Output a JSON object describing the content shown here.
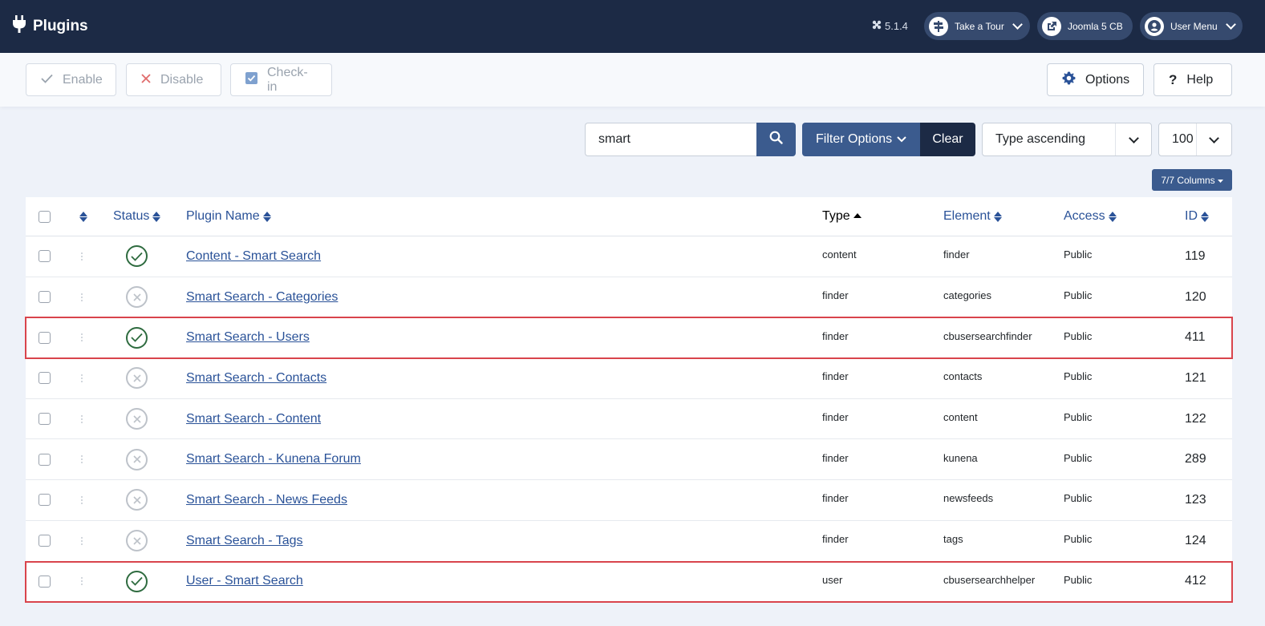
{
  "header": {
    "title": "Plugins",
    "version": "5.1.4",
    "take_tour": "Take a Tour",
    "site_link": "Joomla 5 CB",
    "user_menu": "User Menu"
  },
  "toolbar": {
    "enable": "Enable",
    "disable": "Disable",
    "checkin": "Check-in",
    "options": "Options",
    "help": "Help"
  },
  "filters": {
    "search_value": "smart",
    "filter_options": "Filter Options",
    "clear": "Clear",
    "ordering": "Type ascending",
    "limit": "100",
    "columns": "7/7 Columns"
  },
  "table": {
    "headers": {
      "status": "Status",
      "plugin_name": "Plugin Name",
      "type": "Type",
      "element": "Element",
      "access": "Access",
      "id": "ID"
    },
    "rows": [
      {
        "name": "Content - Smart Search",
        "type": "content",
        "element": "finder",
        "access": "Public",
        "id": "119",
        "enabled": true,
        "highlight": false
      },
      {
        "name": "Smart Search - Categories",
        "type": "finder",
        "element": "categories",
        "access": "Public",
        "id": "120",
        "enabled": false,
        "highlight": false
      },
      {
        "name": "Smart Search - Users",
        "type": "finder",
        "element": "cbusersearchfinder",
        "access": "Public",
        "id": "411",
        "enabled": true,
        "highlight": true
      },
      {
        "name": "Smart Search - Contacts",
        "type": "finder",
        "element": "contacts",
        "access": "Public",
        "id": "121",
        "enabled": false,
        "highlight": false
      },
      {
        "name": "Smart Search - Content",
        "type": "finder",
        "element": "content",
        "access": "Public",
        "id": "122",
        "enabled": false,
        "highlight": false
      },
      {
        "name": "Smart Search - Kunena Forum",
        "type": "finder",
        "element": "kunena",
        "access": "Public",
        "id": "289",
        "enabled": false,
        "highlight": false
      },
      {
        "name": "Smart Search - News Feeds",
        "type": "finder",
        "element": "newsfeeds",
        "access": "Public",
        "id": "123",
        "enabled": false,
        "highlight": false
      },
      {
        "name": "Smart Search - Tags",
        "type": "finder",
        "element": "tags",
        "access": "Public",
        "id": "124",
        "enabled": false,
        "highlight": false
      },
      {
        "name": "User - Smart Search",
        "type": "user",
        "element": "cbusersearchhelper",
        "access": "Public",
        "id": "412",
        "enabled": true,
        "highlight": true
      }
    ]
  },
  "colors": {
    "header_bg": "#1c2a45",
    "primary": "#3b5b8e",
    "link": "#2a5298",
    "enabled": "#2e6b3f",
    "highlight": "#d9444c"
  }
}
